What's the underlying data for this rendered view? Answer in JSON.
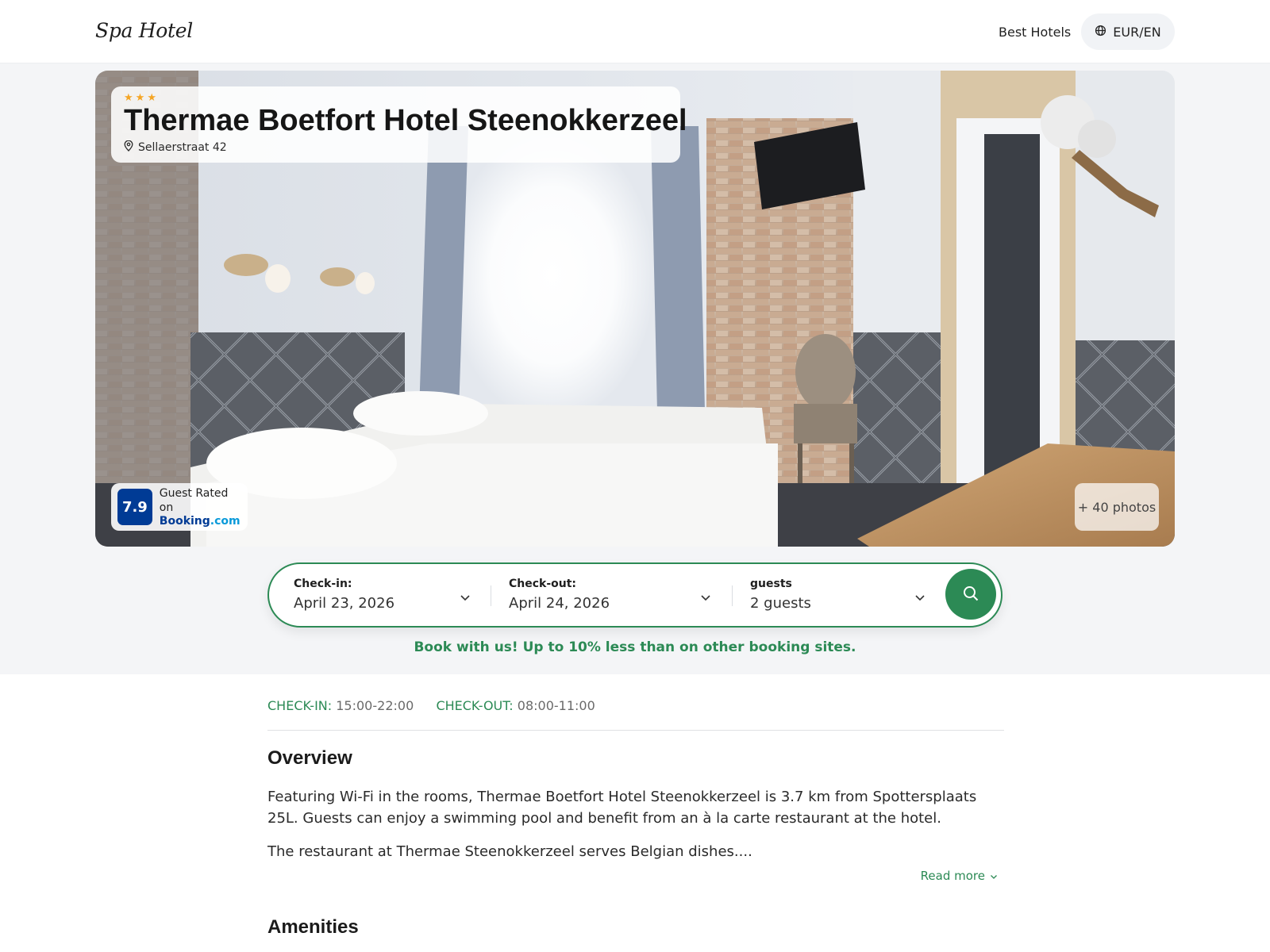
{
  "header": {
    "logo": "Spa Hotel",
    "nav_link": "Best Hotels",
    "currency_language": "EUR/EN"
  },
  "hotel": {
    "stars": 3,
    "name": "Thermae Boetfort Hotel Steenokkerzeel",
    "address": "Sellaerstraat 42",
    "rating": {
      "score": "7.9",
      "label": "Guest Rated on",
      "brand_main": "Booking",
      "brand_suffix": ".com"
    },
    "photos_button": "+ 40 photos"
  },
  "search": {
    "checkin": {
      "label": "Check-in:",
      "value": "April 23, 2026"
    },
    "checkout": {
      "label": "Check-out:",
      "value": "April 24, 2026"
    },
    "guests": {
      "label": "guests",
      "value": "2 guests"
    }
  },
  "promo": "Book with us! Up to 10% less than on other booking sites.",
  "times": {
    "checkin_label": "CHECK-IN:",
    "checkin_value": "15:00-22:00",
    "checkout_label": "CHECK-OUT:",
    "checkout_value": "08:00-11:00"
  },
  "overview": {
    "heading": "Overview",
    "paragraph1": "Featuring Wi-Fi in the rooms, Thermae Boetfort Hotel Steenokkerzeel is 3.7 km from Spottersplaats 25L. Guests can enjoy a swimming pool and benefit from an à la carte restaurant at the hotel.",
    "paragraph2": "The restaurant at Thermae Steenokkerzeel serves Belgian dishes....",
    "read_more": "Read more"
  },
  "amenities": {
    "heading": "Amenities"
  },
  "colors": {
    "accent": "#2c8a55",
    "star": "#f5a524",
    "booking_blue": "#003b95"
  },
  "icons": {
    "globe": "globe-icon",
    "pin": "map-pin-icon",
    "chevron": "chevron-down-icon",
    "search": "search-icon",
    "star": "star-icon"
  }
}
